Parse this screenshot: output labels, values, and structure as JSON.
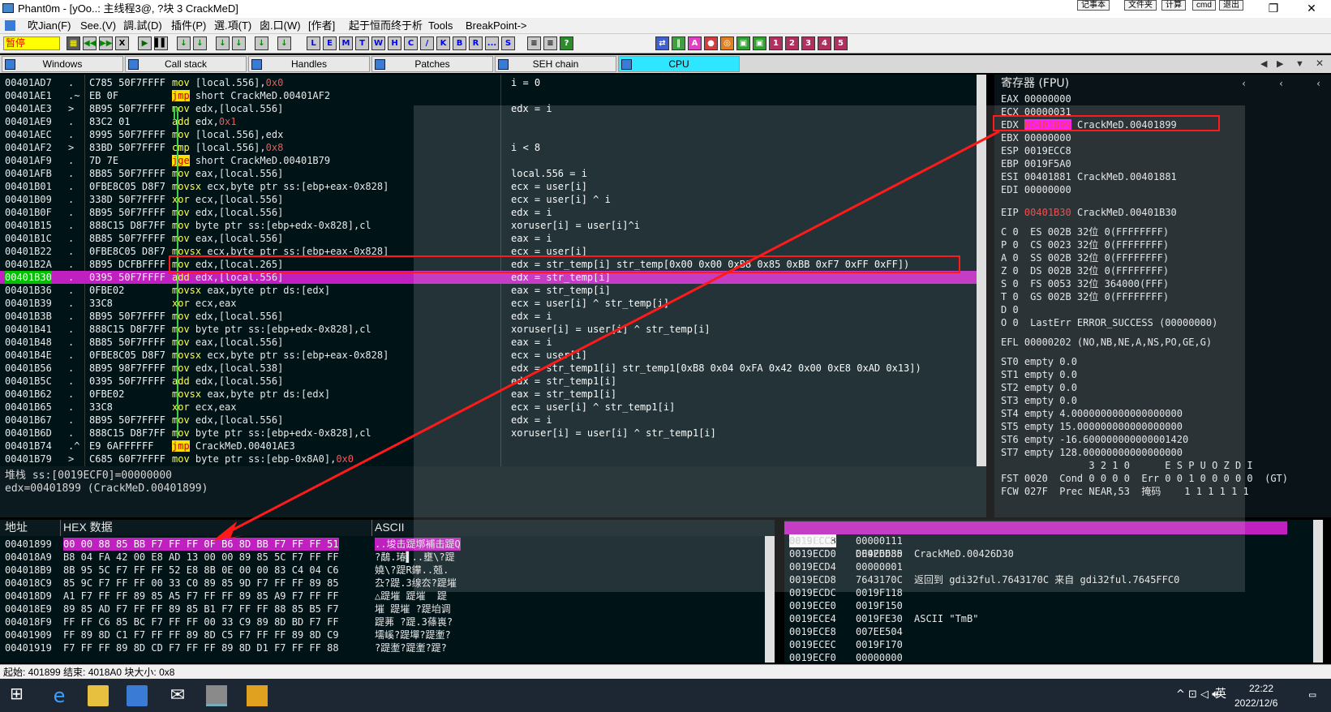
{
  "window": {
    "title": "Phant0m - [yOo..: 主线程3@, ?块 3 CrackMeD]",
    "plugins": [
      "记事本",
      "文件夹",
      "计算",
      "cmd",
      "退出"
    ]
  },
  "menu": [
    "吹Jian(F)",
    "See.(V)",
    "調.試(D)",
    "插件(P)",
    "選.項(T)",
    "囱.口(W)",
    "[作者]",
    "起于恒而终于析",
    "Tools",
    "BreakPoint->"
  ],
  "toolbar": {
    "status": "暂停",
    "run_buttons": [
      "▌▌",
      "◀◀",
      "▶▶",
      "X",
      "▶",
      "▌▌"
    ],
    "step_buttons": [
      "↓",
      "↓",
      "↓",
      "↓",
      "↓",
      "↓"
    ],
    "letter_buttons": [
      "L",
      "E",
      "M",
      "T",
      "W",
      "H",
      "C",
      "/",
      "K",
      "B",
      "R",
      "...",
      "S"
    ],
    "misc_buttons": [
      "≡",
      "≡",
      "?"
    ],
    "colored_buttons": [
      "A",
      "●",
      "◎",
      "▣",
      "▣",
      "1",
      "2",
      "3",
      "4",
      "5"
    ]
  },
  "tabs": [
    {
      "label": "Windows"
    },
    {
      "label": "Call stack"
    },
    {
      "label": "Handles"
    },
    {
      "label": "Patches"
    },
    {
      "label": "SEH chain"
    },
    {
      "label": "CPU",
      "active": true
    }
  ],
  "disassembly": [
    {
      "addr": "00401AD7",
      "mk": ".",
      "bytes": "C785 50F7FFFF",
      "op": "mov",
      "args": "[local.556],",
      "imm": "0x0",
      "cmt": "i = 0"
    },
    {
      "addr": "00401AE1",
      "mk": ".~",
      "bytes": "EB 0F",
      "op": "jmp",
      "args": "short CrackMeD.00401AF2",
      "cmt": ""
    },
    {
      "addr": "00401AE3",
      "mk": ">",
      "bytes": "8B95 50F7FFFF",
      "op": "mov",
      "args": "edx,[local.556]",
      "cmt": "edx = i"
    },
    {
      "addr": "00401AE9",
      "mk": ".",
      "bytes": "83C2 01",
      "op": "add",
      "args": "edx,",
      "imm": "0x1",
      "cmt": ""
    },
    {
      "addr": "00401AEC",
      "mk": ".",
      "bytes": "8995 50F7FFFF",
      "op": "mov",
      "args": "[local.556],edx",
      "cmt": ""
    },
    {
      "addr": "00401AF2",
      "mk": ">",
      "bytes": "83BD 50F7FFFF",
      "op": "cmp",
      "args": "[local.556],",
      "imm": "0x8",
      "cmt": "i < 8"
    },
    {
      "addr": "00401AF9",
      "mk": ".",
      "bytes": "7D 7E",
      "op": "jge",
      "args": "short CrackMeD.00401B79",
      "cmt": ""
    },
    {
      "addr": "00401AFB",
      "mk": ".",
      "bytes": "8B85 50F7FFFF",
      "op": "mov",
      "args": "eax,[local.556]",
      "cmt": "local.556 = i"
    },
    {
      "addr": "00401B01",
      "mk": ".",
      "bytes": "0FBE8C05 D8F7",
      "op": "movsx",
      "args": "ecx,byte ptr ss:[ebp+eax-0x828]",
      "cmt": "ecx = user[i]"
    },
    {
      "addr": "00401B09",
      "mk": ".",
      "bytes": "338D 50F7FFFF",
      "op": "xor",
      "args": "ecx,[local.556]",
      "cmt": "ecx = user[i] ^ i"
    },
    {
      "addr": "00401B0F",
      "mk": ".",
      "bytes": "8B95 50F7FFFF",
      "op": "mov",
      "args": "edx,[local.556]",
      "cmt": "edx = i"
    },
    {
      "addr": "00401B15",
      "mk": ".",
      "bytes": "888C15 D8F7FF",
      "op": "mov",
      "args": "byte ptr ss:[ebp+edx-0x828],cl",
      "cmt": "xoruser[i] = user[i]^i"
    },
    {
      "addr": "00401B1C",
      "mk": ".",
      "bytes": "8B85 50F7FFFF",
      "op": "mov",
      "args": "eax,[local.556]",
      "cmt": "eax = i"
    },
    {
      "addr": "00401B22",
      "mk": ".",
      "bytes": "0FBE8C05 D8F7",
      "op": "movsx",
      "args": "ecx,byte ptr ss:[ebp+eax-0x828]",
      "cmt": "ecx = user[i]"
    },
    {
      "addr": "00401B2A",
      "mk": ".",
      "bytes": "8B95 DCFBFFFF",
      "op": "mov",
      "args": "edx,[local.265]",
      "cmt": "edx = str_temp[i] str_temp[0x00 0x00 0xB8 0x85 0xBB 0xF7 0xFF 0xFF])"
    },
    {
      "addr": "00401B30",
      "mk": ".",
      "bytes": "0395 50F7FFFF",
      "op": "add",
      "args": "edx,[local.556]",
      "cmt": "edx = str_temp[i]",
      "hl": true
    },
    {
      "addr": "00401B36",
      "mk": ".",
      "bytes": "0FBE02",
      "op": "movsx",
      "args": "eax,byte ptr ds:[edx]",
      "cmt": "eax = str_temp[i]"
    },
    {
      "addr": "00401B39",
      "mk": ".",
      "bytes": "33C8",
      "op": "xor",
      "args": "ecx,eax",
      "cmt": "ecx = user[i] ^ str_temp[i]"
    },
    {
      "addr": "00401B3B",
      "mk": ".",
      "bytes": "8B95 50F7FFFF",
      "op": "mov",
      "args": "edx,[local.556]",
      "cmt": "edx = i"
    },
    {
      "addr": "00401B41",
      "mk": ".",
      "bytes": "888C15 D8F7FF",
      "op": "mov",
      "args": "byte ptr ss:[ebp+edx-0x828],cl",
      "cmt": "xoruser[i] = user[i] ^ str_temp[i]"
    },
    {
      "addr": "00401B48",
      "mk": ".",
      "bytes": "8B85 50F7FFFF",
      "op": "mov",
      "args": "eax,[local.556]",
      "cmt": "eax = i"
    },
    {
      "addr": "00401B4E",
      "mk": ".",
      "bytes": "0FBE8C05 D8F7",
      "op": "movsx",
      "args": "ecx,byte ptr ss:[ebp+eax-0x828]",
      "cmt": "ecx = user[i]"
    },
    {
      "addr": "00401B56",
      "mk": ".",
      "bytes": "8B95 98F7FFFF",
      "op": "mov",
      "args": "edx,[local.538]",
      "cmt": "edx = str_temp1[i] str_temp1[0xB8 0x04 0xFA 0x42 0x00 0xE8 0xAD 0x13])"
    },
    {
      "addr": "00401B5C",
      "mk": ".",
      "bytes": "0395 50F7FFFF",
      "op": "add",
      "args": "edx,[local.556]",
      "cmt": "edx = str_temp1[i]"
    },
    {
      "addr": "00401B62",
      "mk": ".",
      "bytes": "0FBE02",
      "op": "movsx",
      "args": "eax,byte ptr ds:[edx]",
      "cmt": "eax = str_temp1[i]"
    },
    {
      "addr": "00401B65",
      "mk": ".",
      "bytes": "33C8",
      "op": "xor",
      "args": "ecx,eax",
      "cmt": "ecx = user[i] ^ str_temp1[i]"
    },
    {
      "addr": "00401B67",
      "mk": ".",
      "bytes": "8B95 50F7FFFF",
      "op": "mov",
      "args": "edx,[local.556]",
      "cmt": "edx = i"
    },
    {
      "addr": "00401B6D",
      "mk": ".",
      "bytes": "888C15 D8F7FF",
      "op": "mov",
      "args": "byte ptr ss:[ebp+edx-0x828],cl",
      "cmt": "xoruser[i] = user[i] ^ str_temp1[i]"
    },
    {
      "addr": "00401B74",
      "mk": ".^",
      "bytes": "E9 6AFFFFFF",
      "op": "jmp",
      "args": "CrackMeD.00401AE3",
      "cmt": ""
    },
    {
      "addr": "00401B79",
      "mk": ">",
      "bytes": "C685 60F7FFFF",
      "op": "mov",
      "args": "byte ptr ss:[ebp-0x8A0],",
      "imm": "0x0",
      "cmt": ""
    }
  ],
  "info": {
    "line1": "堆栈 ss:[0019ECF0]=00000000",
    "line2": "edx=00401899 (CrackMeD.00401899)"
  },
  "registers": {
    "header": "寄存器 (FPU)",
    "gp": [
      {
        "name": "EAX",
        "val": "00000000",
        "note": ""
      },
      {
        "name": "ECX",
        "val": "00000031",
        "note": ""
      },
      {
        "name": "EDX",
        "val": "00401899",
        "note": "CrackMeD.00401899",
        "hl": true
      },
      {
        "name": "EBX",
        "val": "00000000",
        "note": ""
      },
      {
        "name": "ESP",
        "val": "0019ECC8",
        "note": ""
      },
      {
        "name": "EBP",
        "val": "0019F5A0",
        "note": ""
      },
      {
        "name": "ESI",
        "val": "00401881",
        "note": "CrackMeD.00401881"
      },
      {
        "name": "EDI",
        "val": "00000000",
        "note": ""
      }
    ],
    "eip": {
      "name": "EIP",
      "val": "00401B30",
      "note": "CrackMeD.00401B30"
    },
    "flags": [
      "C 0  ES 002B 32位 0(FFFFFFFF)",
      "P 0  CS 0023 32位 0(FFFFFFFF)",
      "A 0  SS 002B 32位 0(FFFFFFFF)",
      "Z 0  DS 002B 32位 0(FFFFFFFF)",
      "S 0  FS 0053 32位 364000(FFF)",
      "T 0  GS 002B 32位 0(FFFFFFFF)",
      "D 0",
      "O 0  LastErr ERROR_SUCCESS (00000000)"
    ],
    "efl": "EFL 00000202 (NO,NB,NE,A,NS,PO,GE,G)",
    "st": [
      "ST0 empty 0.0",
      "ST1 empty 0.0",
      "ST2 empty 0.0",
      "ST3 empty 0.0",
      "ST4 empty 4.0000000000000000000",
      "ST5 empty 15.000000000000000000",
      "ST6 empty -16.600000000000001420",
      "ST7 empty 128.00000000000000000"
    ],
    "fpu_bits": "               3 2 1 0      E S P U O Z D I",
    "fst": "FST 0020  Cond 0 0 0 0  Err 0 0 1 0 0 0 0 0  (GT)",
    "fcw": "FCW 027F  Prec NEAR,53  掩码    1 1 1 1 1 1"
  },
  "dump": {
    "col_addr": "地址",
    "col_hex": "HEX 数据",
    "col_ascii": "ASCII",
    "rows": [
      {
        "addr": "00401899",
        "hex": "00 00 88 85 BB F7 FF FF 0F B6 8D BB F7 FF FF 51",
        "ascii": "..埈击踶墎補击踶Q"
      },
      {
        "addr": "004018A9",
        "hex": "B8 04 FA 42 00 E8 AD 13 00 00 89 85 5C F7 FF FF",
        "ascii": "?鷸.瑃▌..壅\\?踶"
      },
      {
        "addr": "004018B9",
        "hex": "8B 95 5C F7 FF FF 52 E8 8B 0E 00 00 83 C4 04 C6",
        "ascii": "嬈\\?踶R鑻..兡."
      },
      {
        "addr": "004018C9",
        "hex": "85 9C F7 FF FF 00 33 C0 89 85 9D F7 FF FF 89 85",
        "ascii": "厹?踶.3缐厺?踶墔"
      },
      {
        "addr": "004018D9",
        "hex": "A1 F7 FF FF 89 85 A5 F7 FF FF 89 85 A9 F7 FF FF",
        "ascii": "△踶墔 踶墔  踶"
      },
      {
        "addr": "004018E9",
        "hex": "89 85 AD F7 FF FF 89 85 B1 F7 FF FF 88 85 B5 F7",
        "ascii": "墔 踶墔 ?踶垍调"
      },
      {
        "addr": "004018F9",
        "hex": "FF FF C6 85 BC F7 FF FF 00 33 C9 89 8D BD F7 FF",
        "ascii": "踶茀 ?踶.3蓧嵔?"
      },
      {
        "addr": "00401909",
        "hex": "FF 89 8D C1 F7 FF FF 89 8D C5 F7 FF FF 89 8D C9",
        "ascii": "壖嵠?踶墠?踶壍?"
      },
      {
        "addr": "00401919",
        "hex": "F7 FF FF 89 8D CD F7 FF FF 89 8D D1 F7 FF FF 88",
        "ascii": "?踶壍?踶壍?踶?"
      }
    ]
  },
  "stack": {
    "hdr_addr": "0019ECC8",
    "hdr_val": "DE9ED685",
    "rows": [
      {
        "addr": "0019ECCC",
        "val": "00000111",
        "cmt": ""
      },
      {
        "addr": "0019ECD0",
        "val": "00426D30",
        "cmt": "CrackMeD.00426D30"
      },
      {
        "addr": "0019ECD4",
        "val": "00000001",
        "cmt": ""
      },
      {
        "addr": "0019ECD8",
        "val": "7643170C",
        "cmt": "返回到 gdi32ful.7643170C 来自 gdi32ful.7645FFC0"
      },
      {
        "addr": "0019ECDC",
        "val": "0019F118",
        "cmt": ""
      },
      {
        "addr": "0019ECE0",
        "val": "0019F150",
        "cmt": ""
      },
      {
        "addr": "0019ECE4",
        "val": "0019FE30",
        "cmt": "ASCII \"TmB\""
      },
      {
        "addr": "0019ECE8",
        "val": "007EE504",
        "cmt": ""
      },
      {
        "addr": "0019ECEC",
        "val": "0019F170",
        "cmt": ""
      },
      {
        "addr": "0019ECF0",
        "val": "00000000",
        "cmt": ""
      }
    ]
  },
  "statusbar": "起始: 401899 结束: 4018A0 块大小: 0x8",
  "taskbar": {
    "time": "22:22",
    "date": "2022/12/6",
    "ime": "英"
  },
  "colors": {
    "highlight_row": "#c020c0",
    "annotation_red": "#ff1a1a",
    "active_tab": "#2ee6ff",
    "status_yellow": "#ffff00"
  }
}
